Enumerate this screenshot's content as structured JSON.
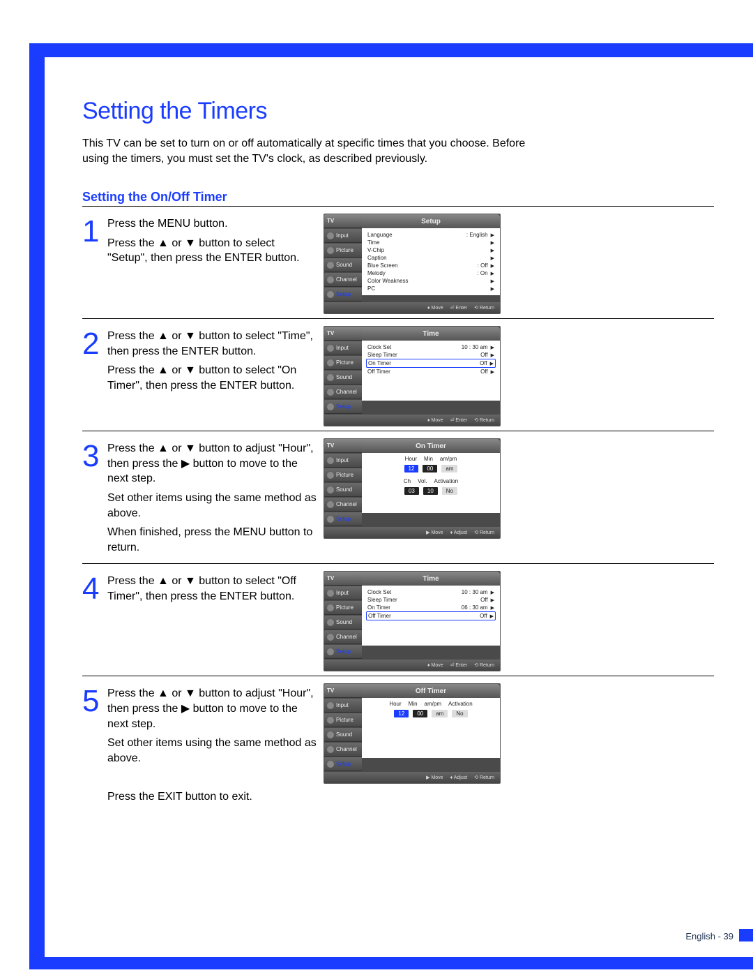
{
  "page": {
    "title": "Setting the Timers",
    "intro": "This TV can be set to turn on or off automatically at specific times that you choose. Before using the timers, you must set the TV's clock, as described previously.",
    "subheading": "Setting the On/Off Timer",
    "footer": "English - 39"
  },
  "steps": [
    {
      "num": "1",
      "lines": [
        "Press the MENU button.",
        "Press the ▲ or ▼ button to select \"Setup\", then press the ENTER button."
      ],
      "osd": {
        "title": "Setup",
        "tabs": [
          "TV",
          "Input",
          "Picture",
          "Sound",
          "Channel",
          "Setup"
        ],
        "selTab": "Setup",
        "rows": [
          {
            "label": "Language",
            "value": ": English",
            "tri": "▶"
          },
          {
            "label": "Time",
            "value": "",
            "tri": "▶"
          },
          {
            "label": "V-Chip",
            "value": "",
            "tri": "▶"
          },
          {
            "label": "Caption",
            "value": "",
            "tri": "▶"
          },
          {
            "label": "Blue Screen",
            "value": ": Off",
            "tri": "▶"
          },
          {
            "label": "Melody",
            "value": ": On",
            "tri": "▶"
          },
          {
            "label": "Color Weakness",
            "value": "",
            "tri": "▶"
          },
          {
            "label": "PC",
            "value": "",
            "tri": "▶"
          }
        ],
        "highlightIndex": -1,
        "footer": [
          "♦ Move",
          "⏎ Enter",
          "⟲ Return"
        ]
      }
    },
    {
      "num": "2",
      "lines": [
        "Press the ▲ or ▼ button to select \"Time\", then press the ENTER button.",
        "Press the ▲ or ▼ button to select \"On Timer\", then press the ENTER button."
      ],
      "osd": {
        "title": "Time",
        "tabs": [
          "TV",
          "Input",
          "Picture",
          "Sound",
          "Channel",
          "Setup"
        ],
        "selTab": "Setup",
        "rows": [
          {
            "label": "Clock Set",
            "value": "10 : 30  am",
            "tri": "▶"
          },
          {
            "label": "Sleep Timer",
            "value": "Off",
            "tri": "▶"
          },
          {
            "label": "On Timer",
            "value": "Off",
            "tri": "▶"
          },
          {
            "label": "Off Timer",
            "value": "Off",
            "tri": "▶"
          }
        ],
        "highlightIndex": 2,
        "footer": [
          "♦ Move",
          "⏎ Enter",
          "⟲ Return"
        ]
      }
    },
    {
      "num": "3",
      "lines": [
        "Press the ▲ or ▼ button to adjust \"Hour\", then press the ▶ button to move to the next step.",
        "Set other items using the same method as above.",
        "When finished, press the MENU button to return."
      ],
      "osd": {
        "title": "On Timer",
        "tabs": [
          "TV",
          "Input",
          "Picture",
          "Sound",
          "Channel",
          "Setup"
        ],
        "selTab": "Setup",
        "timerHeaders1": [
          "Hour",
          "Min",
          "am/pm"
        ],
        "timerValues1": [
          {
            "v": "12",
            "sel": true
          },
          {
            "v": "00"
          },
          {
            "v": "am",
            "light": true
          }
        ],
        "timerHeaders2": [
          "Ch",
          "Vol.",
          "Activation"
        ],
        "timerValues2": [
          {
            "v": "03"
          },
          {
            "v": "10"
          },
          {
            "v": "No",
            "light": true
          }
        ],
        "footer": [
          "▶ Move",
          "♦ Adjust",
          "⟲ Return"
        ]
      }
    },
    {
      "num": "4",
      "lines": [
        "Press the ▲ or ▼ button to select \"Off Timer\", then press the ENTER button."
      ],
      "osd": {
        "title": "Time",
        "tabs": [
          "TV",
          "Input",
          "Picture",
          "Sound",
          "Channel",
          "Setup"
        ],
        "selTab": "Setup",
        "rows": [
          {
            "label": "Clock Set",
            "value": "10 : 30  am",
            "tri": "▶"
          },
          {
            "label": "Sleep Timer",
            "value": "Off",
            "tri": "▶"
          },
          {
            "label": "On Timer",
            "value": "06 : 30  am",
            "tri": "▶"
          },
          {
            "label": "Off Timer",
            "value": "Off",
            "tri": "▶"
          }
        ],
        "highlightIndex": 3,
        "footer": [
          "♦ Move",
          "⏎ Enter",
          "⟲ Return"
        ]
      }
    },
    {
      "num": "5",
      "lines": [
        "Press the ▲ or ▼ button to adjust \"Hour\", then press the ▶ button to move to the next step.",
        "Set other items using the same method as above.",
        "",
        "Press the EXIT button to exit."
      ],
      "osd": {
        "title": "Off Timer",
        "tabs": [
          "TV",
          "Input",
          "Picture",
          "Sound",
          "Channel",
          "Setup"
        ],
        "selTab": "Setup",
        "timerHeaders1": [
          "Hour",
          "Min",
          "am/pm",
          "Activation"
        ],
        "timerValues1": [
          {
            "v": "12",
            "sel": true
          },
          {
            "v": "00"
          },
          {
            "v": "am",
            "light": true
          },
          {
            "v": "No",
            "light": true
          }
        ],
        "footer": [
          "▶ Move",
          "♦ Adjust",
          "⟲ Return"
        ]
      }
    }
  ]
}
